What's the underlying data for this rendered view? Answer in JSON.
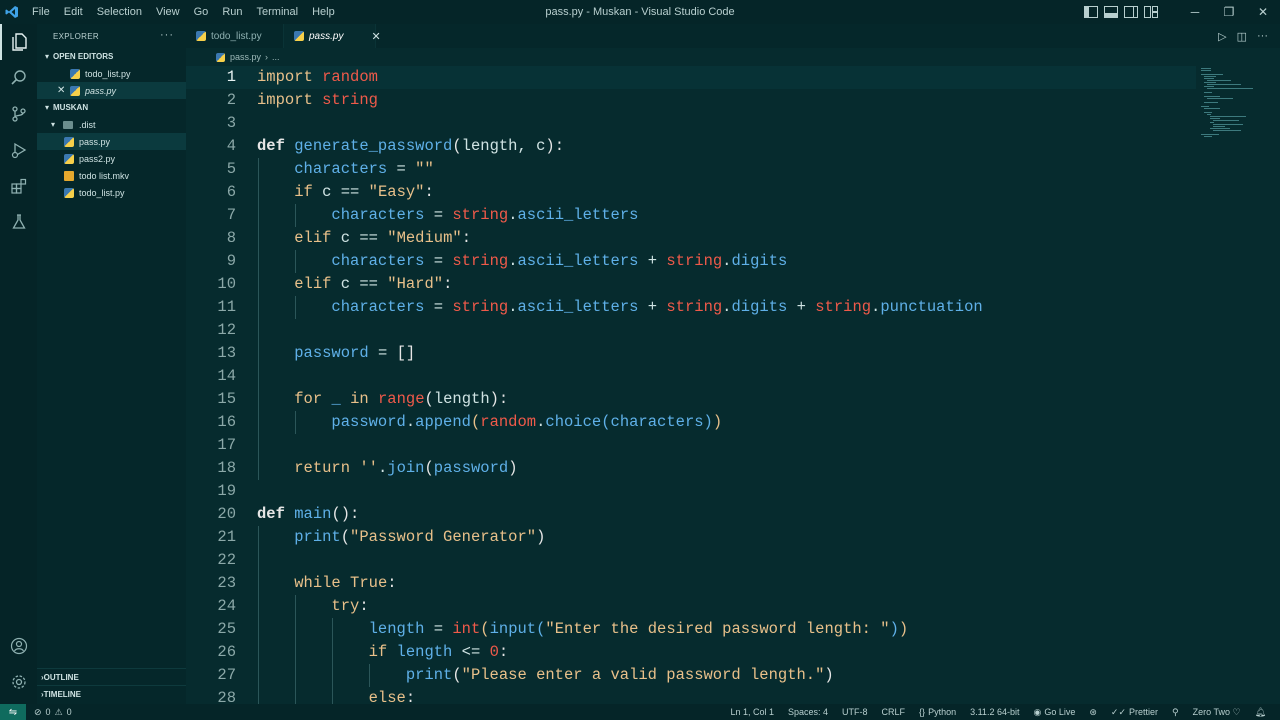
{
  "window": {
    "title": "pass.py - Muskan - Visual Studio Code",
    "menu": [
      "File",
      "Edit",
      "Selection",
      "View",
      "Go",
      "Run",
      "Terminal",
      "Help"
    ]
  },
  "sidebar": {
    "header": "EXPLORER",
    "open_editors_label": "OPEN EDITORS",
    "open_editors": [
      {
        "name": "todo_list.py"
      },
      {
        "name": "pass.py"
      }
    ],
    "folder_label": "MUSKAN",
    "tree": [
      {
        "name": ".dist",
        "type": "folder"
      },
      {
        "name": "pass.py",
        "type": "py"
      },
      {
        "name": "pass2.py",
        "type": "py"
      },
      {
        "name": "todo list.mkv",
        "type": "mkv"
      },
      {
        "name": "todo_list.py",
        "type": "py"
      }
    ],
    "outline_label": "OUTLINE",
    "timeline_label": "TIMELINE"
  },
  "tabs": [
    {
      "label": "todo_list.py",
      "active": false
    },
    {
      "label": "pass.py",
      "active": true
    }
  ],
  "breadcrumb": {
    "file": "pass.py",
    "rest": "..."
  },
  "editor": {
    "line_numbers": [
      "1",
      "2",
      "3",
      "4",
      "5",
      "6",
      "7",
      "8",
      "9",
      "10",
      "11",
      "12",
      "13",
      "14",
      "15",
      "16",
      "17",
      "18",
      "19",
      "20",
      "21",
      "22",
      "23",
      "24",
      "25",
      "26",
      "27",
      "28"
    ],
    "current_line": "1"
  },
  "status": {
    "errors": "0",
    "warnings": "0",
    "position": "Ln 1, Col 1",
    "spaces": "Spaces: 4",
    "encoding": "UTF-8",
    "eol": "CRLF",
    "language": "Python",
    "interpreter": "3.11.2 64-bit",
    "golive": "Go Live",
    "prettier": "Prettier",
    "theme": "Zero Two"
  },
  "colors": {
    "background": "#062b2e",
    "keyword": "#e8c08a",
    "module": "#ef5a4a",
    "function": "#5fb0e8"
  }
}
